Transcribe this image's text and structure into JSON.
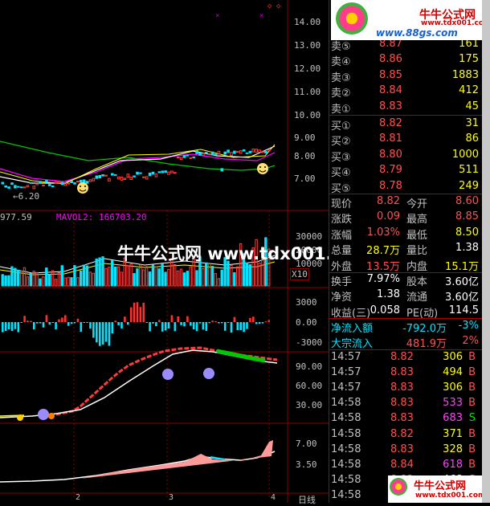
{
  "colors": {
    "up": "#ff3c3c",
    "down": "#00e5ff",
    "grid": "#8b0000",
    "yellow": "#ffff00",
    "white": "#ffffff",
    "magenta": "#ff00ff",
    "green": "#00c800"
  },
  "price_axis": {
    "labels": [
      "14.00",
      "13.00",
      "12.00",
      "11.00",
      "10.00",
      "9.00",
      "8.00",
      "7.00"
    ]
  },
  "price_chart": {
    "low_label": "←6.20",
    "smiley": "smiley-icon"
  },
  "volume_panel": {
    "left_label": "977.59",
    "mavol_label": "MAVOL2: 166703.20",
    "axis": [
      "30000",
      "20000",
      "10000"
    ],
    "unit": "X10"
  },
  "flow_panel": {
    "axis": [
      "3000",
      "0.00",
      "-3000"
    ]
  },
  "indicator_panel": {
    "axis": [
      "90.00",
      "60.00",
      "30.00"
    ]
  },
  "bottom_panel": {
    "axis": [
      "7.00",
      "3.50"
    ]
  },
  "x_axis": {
    "ticks": [
      "2",
      "3",
      "4"
    ],
    "period_label": "日线"
  },
  "watermark": {
    "text": "牛牛公式网 www.tdx001.com"
  },
  "logo_top": {
    "title": "牛牛公式网",
    "url": "www.88gs.com",
    "url2": "www.tdx001.com"
  },
  "logo_bottom": {
    "title": "牛牛公式网",
    "url": "www.tdx001.com"
  },
  "order_book": {
    "asks": [
      {
        "label": "卖⑤",
        "price": "8.87",
        "vol": "161"
      },
      {
        "label": "卖④",
        "price": "8.86",
        "vol": "175"
      },
      {
        "label": "卖③",
        "price": "8.85",
        "vol": "1883"
      },
      {
        "label": "卖②",
        "price": "8.84",
        "vol": "412"
      },
      {
        "label": "卖①",
        "price": "8.83",
        "vol": "45"
      }
    ],
    "bids": [
      {
        "label": "买①",
        "price": "8.82",
        "vol": "31"
      },
      {
        "label": "买②",
        "price": "8.81",
        "vol": "86"
      },
      {
        "label": "买③",
        "price": "8.80",
        "vol": "1000"
      },
      {
        "label": "买④",
        "price": "8.79",
        "vol": "511"
      },
      {
        "label": "买⑤",
        "price": "8.78",
        "vol": "249"
      }
    ]
  },
  "stats": [
    {
      "l1": "现价",
      "v1": "8.82",
      "l2": "今开",
      "v2": "8.60"
    },
    {
      "l1": "涨跌",
      "v1": "0.09",
      "l2": "最高",
      "v2": "8.85"
    },
    {
      "l1": "涨幅",
      "v1": "1.03%",
      "l2": "最低",
      "v2": "8.50"
    },
    {
      "l1": "总量",
      "v1": "28.7万",
      "l2": "量比",
      "v2": "1.38"
    },
    {
      "l1": "外盘",
      "v1": "13.5万",
      "l2": "内盘",
      "v2": "15.1万"
    },
    {
      "l1": "换手",
      "v1": "7.97%",
      "l2": "股本",
      "v2": "3.60亿"
    },
    {
      "l1": "净资",
      "v1": "1.38",
      "l2": "流通",
      "v2": "3.60亿"
    },
    {
      "l1": "收益(三)",
      "v1": "0.058",
      "l2": "PE(动)",
      "v2": "114.5"
    }
  ],
  "flows": [
    {
      "label": "净流入额",
      "value": "-792.0万",
      "pct": "-3%"
    },
    {
      "label": "大宗流入",
      "value": "481.9万",
      "pct": "2%"
    }
  ],
  "ticks": [
    {
      "time": "14:57",
      "price": "8.82",
      "vol": "306",
      "side": "B"
    },
    {
      "time": "14:57",
      "price": "8.83",
      "vol": "494",
      "side": "B"
    },
    {
      "time": "14:57",
      "price": "8.83",
      "vol": "306",
      "side": "B"
    },
    {
      "time": "14:58",
      "price": "8.83",
      "vol": "533",
      "side": "B"
    },
    {
      "time": "14:58",
      "price": "8.83",
      "vol": "683",
      "side": "S"
    },
    {
      "time": "14:58",
      "price": "8.82",
      "vol": "371",
      "side": "B"
    },
    {
      "time": "14:58",
      "price": "8.83",
      "vol": "328",
      "side": "B"
    },
    {
      "time": "14:58",
      "price": "8.84",
      "vol": "618",
      "side": "B"
    },
    {
      "time": "14:58",
      "price": "8.82",
      "vol": "468",
      "side": "S"
    },
    {
      "time": "14:58",
      "price": "",
      "vol": "",
      "side": ""
    }
  ]
}
